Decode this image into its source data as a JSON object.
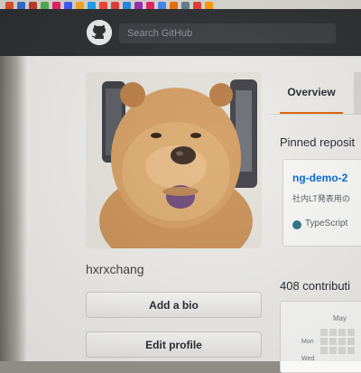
{
  "header": {
    "search_placeholder": "Search GitHub",
    "bookmark_colors": [
      "#e44d26",
      "#2f6fd6",
      "#c0392b",
      "#4caf50",
      "#e91e63",
      "#3d5afe",
      "#f5a623",
      "#1da1f2",
      "#f44336",
      "#e53935",
      "#1e88e5",
      "#9c27b0",
      "#e91e63",
      "#4285f4",
      "#ef6c00",
      "#607d8b",
      "#e53935",
      "#ff9800"
    ]
  },
  "profile": {
    "username": "hxrxchang",
    "add_bio_label": "Add a bio",
    "edit_profile_label": "Edit profile"
  },
  "tabs": {
    "overview_label": "Overview"
  },
  "pinned": {
    "title": "Pinned reposit",
    "repo_name": "ng-demo-2",
    "repo_description": "社内LT発表用の",
    "language": "TypeScript",
    "language_color": "#2b7489"
  },
  "contributions": {
    "title": "408 contributi",
    "month": "May",
    "day_mon": "Mon",
    "day_wed": "Wed"
  }
}
